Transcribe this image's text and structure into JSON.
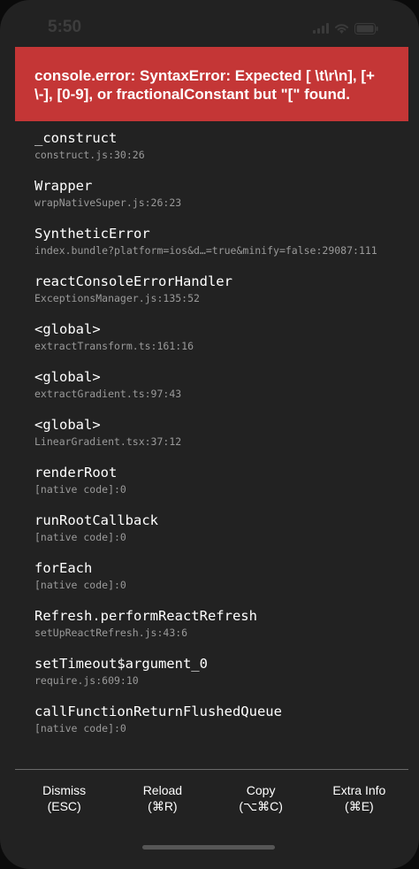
{
  "status_bar": {
    "time": "5:50"
  },
  "error": {
    "message": "console.error: SyntaxError: Expected [ \\t\\r\\n], [+ \\-], [0-9], or fractionalConstant but \"[\" found."
  },
  "stack": [
    {
      "name": "_construct",
      "file": "construct.js:30:26"
    },
    {
      "name": "Wrapper",
      "file": "wrapNativeSuper.js:26:23"
    },
    {
      "name": "SyntheticError",
      "file": "index.bundle?platform=ios&d…=true&minify=false:29087:111"
    },
    {
      "name": "reactConsoleErrorHandler",
      "file": "ExceptionsManager.js:135:52"
    },
    {
      "name": "<global>",
      "file": "extractTransform.ts:161:16"
    },
    {
      "name": "<global>",
      "file": "extractGradient.ts:97:43"
    },
    {
      "name": "<global>",
      "file": "LinearGradient.tsx:37:12"
    },
    {
      "name": "renderRoot",
      "file": "[native code]:0"
    },
    {
      "name": "runRootCallback",
      "file": "[native code]:0"
    },
    {
      "name": "forEach",
      "file": "[native code]:0"
    },
    {
      "name": "Refresh.performReactRefresh",
      "file": "setUpReactRefresh.js:43:6"
    },
    {
      "name": "setTimeout$argument_0",
      "file": "require.js:609:10"
    },
    {
      "name": "callFunctionReturnFlushedQueue",
      "file": "[native code]:0"
    }
  ],
  "footer": {
    "dismiss": {
      "label": "Dismiss",
      "shortcut": "(ESC)"
    },
    "reload": {
      "label": "Reload",
      "shortcut": "(⌘R)"
    },
    "copy": {
      "label": "Copy",
      "shortcut": "(⌥⌘C)"
    },
    "extra_info": {
      "label": "Extra Info",
      "shortcut": "(⌘E)"
    }
  },
  "icons": [
    "cellular-signal-icon",
    "wifi-icon",
    "battery-icon"
  ]
}
